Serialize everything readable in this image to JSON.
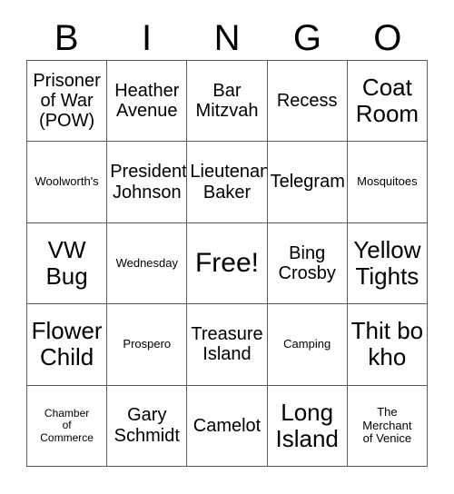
{
  "card": {
    "title": "BINGO",
    "header_letters": [
      "B",
      "I",
      "N",
      "G",
      "O"
    ],
    "colors": {
      "background": "#ffffff",
      "text": "#000000",
      "grid_line": "#5a5a5a"
    },
    "grid_size": "5x5",
    "free_space": "Free!",
    "rows": [
      [
        {
          "label": "Prisoner\nof War\n(POW)",
          "size": "md",
          "free": false
        },
        {
          "label": "Heather\nAvenue",
          "size": "md",
          "free": false
        },
        {
          "label": "Bar\nMitzvah",
          "size": "md",
          "free": false
        },
        {
          "label": "Recess",
          "size": "md",
          "free": false
        },
        {
          "label": "Coat\nRoom",
          "size": "lg",
          "free": false
        }
      ],
      [
        {
          "label": "Woolworth's",
          "size": "sm",
          "free": false
        },
        {
          "label": "President\nJohnson",
          "size": "md",
          "free": false
        },
        {
          "label": "Lieutenant\nBaker",
          "size": "md",
          "free": false
        },
        {
          "label": "Telegram",
          "size": "md",
          "free": false
        },
        {
          "label": "Mosquitoes",
          "size": "sm",
          "free": false
        }
      ],
      [
        {
          "label": "VW\nBug",
          "size": "lg",
          "free": false
        },
        {
          "label": "Wednesday",
          "size": "sm",
          "free": false
        },
        {
          "label": "Free!",
          "size": "free",
          "free": true
        },
        {
          "label": "Bing\nCrosby",
          "size": "md",
          "free": false
        },
        {
          "label": "Yellow\nTights",
          "size": "lg",
          "free": false
        }
      ],
      [
        {
          "label": "Flower\nChild",
          "size": "lg",
          "free": false
        },
        {
          "label": "Prospero",
          "size": "sm",
          "free": false
        },
        {
          "label": "Treasure\nIsland",
          "size": "md",
          "free": false
        },
        {
          "label": "Camping",
          "size": "sm",
          "free": false
        },
        {
          "label": "Thit bo\nkho",
          "size": "lg",
          "free": false
        }
      ],
      [
        {
          "label": "Chamber\nof\nCommerce",
          "size": "xs",
          "free": false
        },
        {
          "label": "Gary\nSchmidt",
          "size": "md",
          "free": false
        },
        {
          "label": "Camelot",
          "size": "md",
          "free": false
        },
        {
          "label": "Long\nIsland",
          "size": "lg",
          "free": false
        },
        {
          "label": "The\nMerchant\nof Venice",
          "size": "sm",
          "free": false
        }
      ]
    ]
  }
}
